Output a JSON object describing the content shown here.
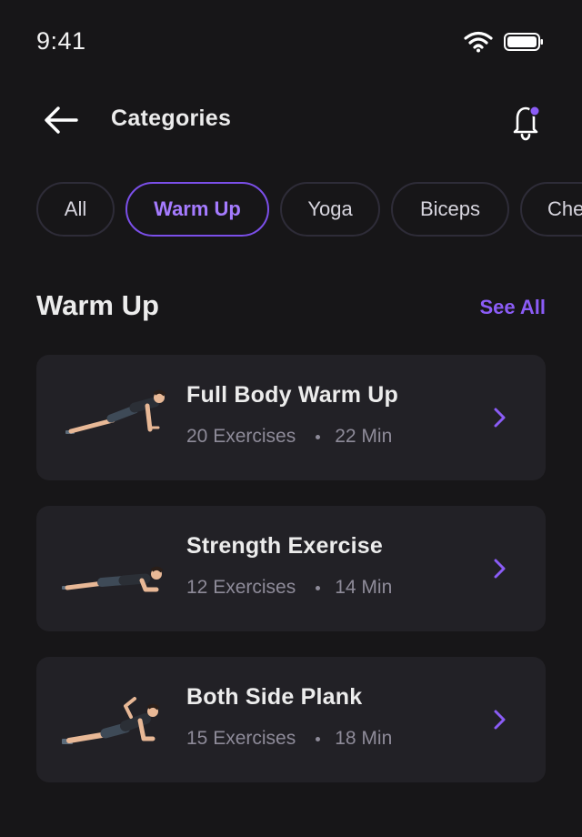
{
  "status_bar": {
    "time": "9:41"
  },
  "header": {
    "title": "Categories",
    "back_icon": "arrow-left-icon",
    "notification_icon": "bell-icon"
  },
  "chips": [
    {
      "label": "All",
      "active": false
    },
    {
      "label": "Warm Up",
      "active": true
    },
    {
      "label": "Yoga",
      "active": false
    },
    {
      "label": "Biceps",
      "active": false
    },
    {
      "label": "Che",
      "active": false
    }
  ],
  "section": {
    "title": "Warm Up",
    "see_all": "See All"
  },
  "workouts": [
    {
      "title": "Full Body Warm Up",
      "exercises": "20 Exercises",
      "duration": "22 Min"
    },
    {
      "title": "Strength Exercise",
      "exercises": "12 Exercises",
      "duration": "14 Min"
    },
    {
      "title": "Both Side Plank",
      "exercises": "15 Exercises",
      "duration": "18 Min"
    }
  ],
  "colors": {
    "background": "#171618",
    "card": "#222126",
    "accent": "#8b5cf6",
    "chip_border": "#2e2c38",
    "muted_text": "#8e8b99"
  }
}
